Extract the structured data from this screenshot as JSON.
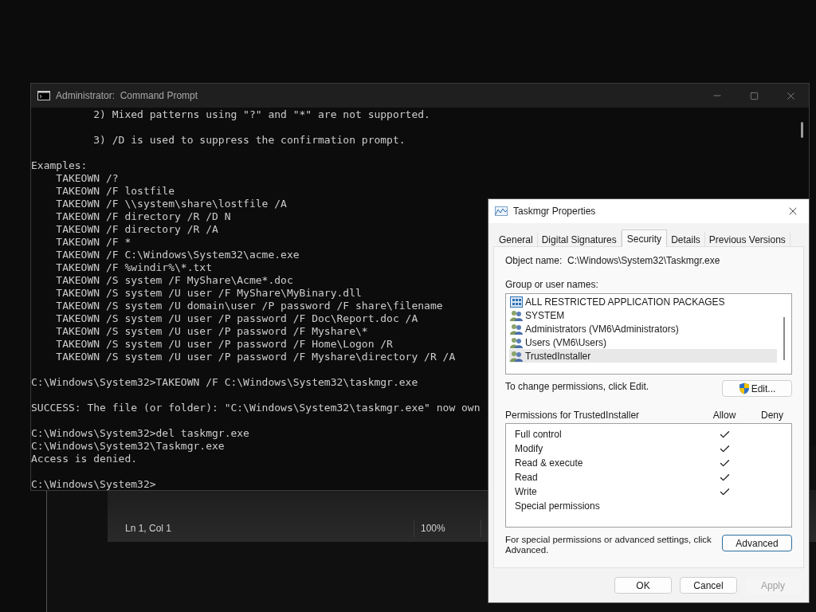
{
  "console": {
    "title": "Administrator:  Command Prompt",
    "blocks": [
      [
        "          2) Mixed patterns using \"?\" and \"*\" are not supported."
      ],
      [
        "          3) /D is used to suppress the confirmation prompt."
      ],
      [
        "Examples:",
        "    TAKEOWN /?",
        "    TAKEOWN /F lostfile",
        "    TAKEOWN /F \\\\system\\share\\lostfile /A",
        "    TAKEOWN /F directory /R /D N",
        "    TAKEOWN /F directory /R /A",
        "    TAKEOWN /F *",
        "    TAKEOWN /F C:\\Windows\\System32\\acme.exe",
        "    TAKEOWN /F %windir%\\*.txt",
        "    TAKEOWN /S system /F MyShare\\Acme*.doc",
        "    TAKEOWN /S system /U user /F MyShare\\MyBinary.dll",
        "    TAKEOWN /S system /U domain\\user /P password /F share\\filename",
        "    TAKEOWN /S system /U user /P password /F Doc\\Report.doc /A",
        "    TAKEOWN /S system /U user /P password /F Myshare\\*",
        "    TAKEOWN /S system /U user /P password /F Home\\Logon /R",
        "    TAKEOWN /S system /U user /P password /F Myshare\\directory /R /A"
      ],
      [
        "C:\\Windows\\System32>TAKEOWN /F C:\\Windows\\System32\\taskmgr.exe"
      ],
      [
        "SUCCESS: The file (or folder): \"C:\\Windows\\System32\\taskmgr.exe\" now own"
      ],
      [
        "C:\\Windows\\System32>del taskmgr.exe",
        "C:\\Windows\\System32\\Taskmgr.exe",
        "Access is denied."
      ],
      [
        "C:\\Windows\\System32>"
      ]
    ]
  },
  "editor_status": {
    "position": "Ln 1, Col 1",
    "zoom": "100%"
  },
  "dialog": {
    "title": "Taskmgr Properties",
    "tabs": [
      {
        "label": "General",
        "selected": false
      },
      {
        "label": "Digital Signatures",
        "selected": false
      },
      {
        "label": "Security",
        "selected": true
      },
      {
        "label": "Details",
        "selected": false
      },
      {
        "label": "Previous Versions",
        "selected": false
      }
    ],
    "object_label": "Object name:",
    "object_value": "C:\\Windows\\System32\\Taskmgr.exe",
    "groups_label": "Group or user names:",
    "groups": [
      {
        "name": "ALL RESTRICTED APPLICATION PACKAGES",
        "kind": "package",
        "selected": false
      },
      {
        "name": "SYSTEM",
        "kind": "group",
        "selected": false
      },
      {
        "name": "Administrators (VM6\\Administrators)",
        "kind": "group",
        "selected": false
      },
      {
        "name": "Users (VM6\\Users)",
        "kind": "group",
        "selected": false
      },
      {
        "name": "TrustedInstaller",
        "kind": "group",
        "selected": true
      }
    ],
    "change_hint": "To change permissions, click Edit.",
    "edit_button": "Edit...",
    "permissions_label": "Permissions for TrustedInstaller",
    "allow_header": "Allow",
    "deny_header": "Deny",
    "permissions": [
      {
        "name": "Full control",
        "allow": true,
        "deny": false
      },
      {
        "name": "Modify",
        "allow": true,
        "deny": false
      },
      {
        "name": "Read & execute",
        "allow": true,
        "deny": false
      },
      {
        "name": "Read",
        "allow": true,
        "deny": false
      },
      {
        "name": "Write",
        "allow": true,
        "deny": false
      },
      {
        "name": "Special permissions",
        "allow": false,
        "deny": false
      }
    ],
    "advanced_hint": "For special permissions or advanced settings, click Advanced.",
    "advanced_button": "Advanced",
    "buttons": [
      {
        "label": "OK",
        "disabled": false
      },
      {
        "label": "Cancel",
        "disabled": false
      },
      {
        "label": "Apply",
        "disabled": true
      }
    ]
  }
}
